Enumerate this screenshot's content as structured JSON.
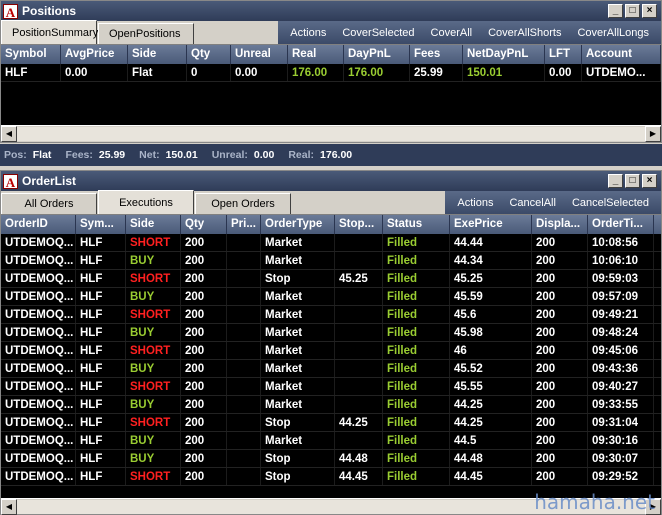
{
  "positions": {
    "title": "Positions",
    "tabs": [
      "PositionSummary",
      "OpenPositions"
    ],
    "actions": [
      "Actions",
      "CoverSelected",
      "CoverAll",
      "CoverAllShorts",
      "CoverAllLongs"
    ],
    "columns": [
      "Symbol",
      "AvgPrice",
      "Side",
      "Qty",
      "Unreal",
      "Real",
      "DayPnL",
      "Fees",
      "NetDayPnL",
      "LFT",
      "Account"
    ],
    "rows": [
      [
        "HLF",
        "0.00",
        "Flat",
        "0",
        "0.00",
        "176.00",
        "176.00",
        "25.99",
        "150.01",
        "0.00",
        "UTDEMO..."
      ]
    ]
  },
  "status": {
    "pos_label": "Pos:",
    "pos_value": "Flat",
    "fees_label": "Fees:",
    "fees_value": "25.99",
    "net_label": "Net:",
    "net_value": "150.01",
    "unreal_label": "Unreal:",
    "unreal_value": "0.00",
    "real_label": "Real:",
    "real_value": "176.00"
  },
  "orderlist": {
    "title": "OrderList",
    "tabs": [
      "All Orders",
      "Executions",
      "Open Orders"
    ],
    "actions": [
      "Actions",
      "CancelAll",
      "CancelSelected"
    ],
    "columns": [
      "OrderID",
      "Sym...",
      "Side",
      "Qty",
      "Pri...",
      "OrderType",
      "Stop...",
      "Status",
      "ExePrice",
      "Displa...",
      "OrderTi..."
    ],
    "rows": [
      [
        "UTDEMOQ...",
        "HLF",
        "SHORT",
        "200",
        "",
        "Market",
        "",
        "Filled",
        "44.44",
        "200",
        "10:08:56"
      ],
      [
        "UTDEMOQ...",
        "HLF",
        "BUY",
        "200",
        "",
        "Market",
        "",
        "Filled",
        "44.34",
        "200",
        "10:06:10"
      ],
      [
        "UTDEMOQ...",
        "HLF",
        "SHORT",
        "200",
        "",
        "Stop",
        "45.25",
        "Filled",
        "45.25",
        "200",
        "09:59:03"
      ],
      [
        "UTDEMOQ...",
        "HLF",
        "BUY",
        "200",
        "",
        "Market",
        "",
        "Filled",
        "45.59",
        "200",
        "09:57:09"
      ],
      [
        "UTDEMOQ...",
        "HLF",
        "SHORT",
        "200",
        "",
        "Market",
        "",
        "Filled",
        "45.6",
        "200",
        "09:49:21"
      ],
      [
        "UTDEMOQ...",
        "HLF",
        "BUY",
        "200",
        "",
        "Market",
        "",
        "Filled",
        "45.98",
        "200",
        "09:48:24"
      ],
      [
        "UTDEMOQ...",
        "HLF",
        "SHORT",
        "200",
        "",
        "Market",
        "",
        "Filled",
        "46",
        "200",
        "09:45:06"
      ],
      [
        "UTDEMOQ...",
        "HLF",
        "BUY",
        "200",
        "",
        "Market",
        "",
        "Filled",
        "45.52",
        "200",
        "09:43:36"
      ],
      [
        "UTDEMOQ...",
        "HLF",
        "SHORT",
        "200",
        "",
        "Market",
        "",
        "Filled",
        "45.55",
        "200",
        "09:40:27"
      ],
      [
        "UTDEMOQ...",
        "HLF",
        "BUY",
        "200",
        "",
        "Market",
        "",
        "Filled",
        "44.25",
        "200",
        "09:33:55"
      ],
      [
        "UTDEMOQ...",
        "HLF",
        "SHORT",
        "200",
        "",
        "Stop",
        "44.25",
        "Filled",
        "44.25",
        "200",
        "09:31:04"
      ],
      [
        "UTDEMOQ...",
        "HLF",
        "BUY",
        "200",
        "",
        "Market",
        "",
        "Filled",
        "44.5",
        "200",
        "09:30:16"
      ],
      [
        "UTDEMOQ...",
        "HLF",
        "BUY",
        "200",
        "",
        "Stop",
        "44.48",
        "Filled",
        "44.48",
        "200",
        "09:30:07"
      ],
      [
        "UTDEMOQ...",
        "HLF",
        "SHORT",
        "200",
        "",
        "Stop",
        "44.45",
        "Filled",
        "44.45",
        "200",
        "09:29:52"
      ]
    ]
  },
  "watermark": "hamaha.net"
}
